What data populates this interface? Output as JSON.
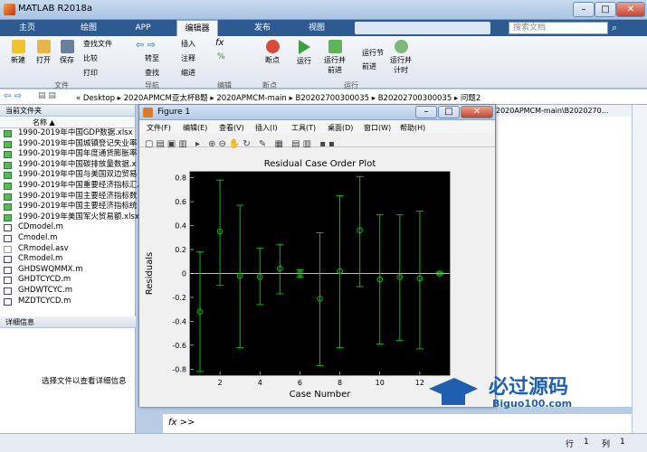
{
  "app": {
    "title": "MATLAB R2018a"
  },
  "tabs": [
    "主页",
    "绘图",
    "APP",
    "编辑器",
    "发布",
    "视图"
  ],
  "search": {
    "placeholder": "搜索文档"
  },
  "ribbon": {
    "file": {
      "new": "新建",
      "open": "打开",
      "save": "保存",
      "find_files": "查找文件",
      "compare": "比较",
      "print": "打印",
      "group": "文件"
    },
    "nav": {
      "goto": "转至",
      "find": "查找",
      "group": "导航"
    },
    "edit": {
      "insert": "插入",
      "comment": "注释",
      "indent": "缩进",
      "group": "编辑"
    },
    "breakpoints": {
      "label": "断点",
      "group": "断点"
    },
    "run": {
      "run": "运行",
      "run_advance": "运行并\n前进",
      "run_section": "运行节",
      "advance": "前进",
      "run_time": "运行并\n计时",
      "group": "运行"
    }
  },
  "address": {
    "path": [
      "Desktop",
      "2020APMCM亚太杯B题",
      "2020APMCM-main",
      "B20202700300035",
      "B20202700300035",
      "问题2"
    ],
    "extra": "2020APMCM-main\\B2020270..."
  },
  "current_folder": {
    "title": "当前文件夹",
    "column": "名称 ▲",
    "files": [
      {
        "name": "1990-2019年中国GDP数据.xlsx",
        "type": "xls"
      },
      {
        "name": "1990-2019年中国城镇登记失业率",
        "type": "xls"
      },
      {
        "name": "1990-2019年中国年度通货膨胀率",
        "type": "xls"
      },
      {
        "name": "1990-2019年中国碳排放量数据.x",
        "type": "xls"
      },
      {
        "name": "1990-2019年中国与美国双边贸易",
        "type": "xls"
      },
      {
        "name": "1990-2019年中国重要经济指标汇总",
        "type": "xls"
      },
      {
        "name": "1990-2019年中国主要经济指标数",
        "type": "xls"
      },
      {
        "name": "1990-2019年中国主要经济指标统",
        "type": "xls"
      },
      {
        "name": "1990-2019年美国军火贸易额.xlsx",
        "type": "xls"
      },
      {
        "name": "CDmodel.m",
        "type": "m"
      },
      {
        "name": "Cmodel.m",
        "type": "m"
      },
      {
        "name": "CRmodel.asv",
        "type": "asv"
      },
      {
        "name": "CRmodel.m",
        "type": "m"
      },
      {
        "name": "GHDSWQMMX.m",
        "type": "m"
      },
      {
        "name": "GHDTCYCD.m",
        "type": "m"
      },
      {
        "name": "GHDWTCYC.m",
        "type": "m"
      },
      {
        "name": "MZDTCYCD.m",
        "type": "m"
      }
    ]
  },
  "details": {
    "title": "详细信息",
    "hint": "选择文件以查看详细信息"
  },
  "figure": {
    "title": "Figure 1",
    "menu": [
      "文件(F)",
      "编辑(E)",
      "查看(V)",
      "插入(I)",
      "工具(T)",
      "桌面(D)",
      "窗口(W)",
      "帮助(H)"
    ]
  },
  "chart_data": {
    "type": "scatter",
    "title": "Residual Case Order Plot",
    "xlabel": "Case Number",
    "ylabel": "Residuals",
    "xlim": [
      0.5,
      13.5
    ],
    "ylim": [
      -0.85,
      0.85
    ],
    "xticks": [
      2,
      4,
      6,
      8,
      10,
      12
    ],
    "yticks": [
      -0.8,
      -0.6,
      -0.4,
      -0.2,
      0,
      0.2,
      0.4,
      0.6,
      0.8
    ],
    "x": [
      1,
      2,
      3,
      4,
      5,
      6,
      7,
      8,
      9,
      10,
      11,
      12,
      13
    ],
    "y": [
      -0.32,
      0.35,
      -0.02,
      -0.03,
      0.04,
      0.0,
      -0.21,
      0.02,
      0.36,
      -0.05,
      -0.03,
      -0.04,
      0.0
    ],
    "lower": [
      -0.82,
      -0.1,
      -0.62,
      -0.26,
      -0.17,
      -0.03,
      -0.77,
      -0.62,
      -0.11,
      -0.59,
      -0.56,
      -0.63,
      -0.01
    ],
    "upper": [
      0.18,
      0.78,
      0.57,
      0.21,
      0.24,
      0.03,
      0.34,
      0.65,
      0.81,
      0.49,
      0.49,
      0.52,
      0.01
    ],
    "background": "#000000",
    "color": "#00c000"
  },
  "cmd": {
    "prompt": "fx >>"
  },
  "status": {
    "row_label": "行",
    "row": "1",
    "col_label": "列",
    "col": "1"
  },
  "watermark": {
    "text": "必过源码",
    "url": "Biguo100.com"
  }
}
